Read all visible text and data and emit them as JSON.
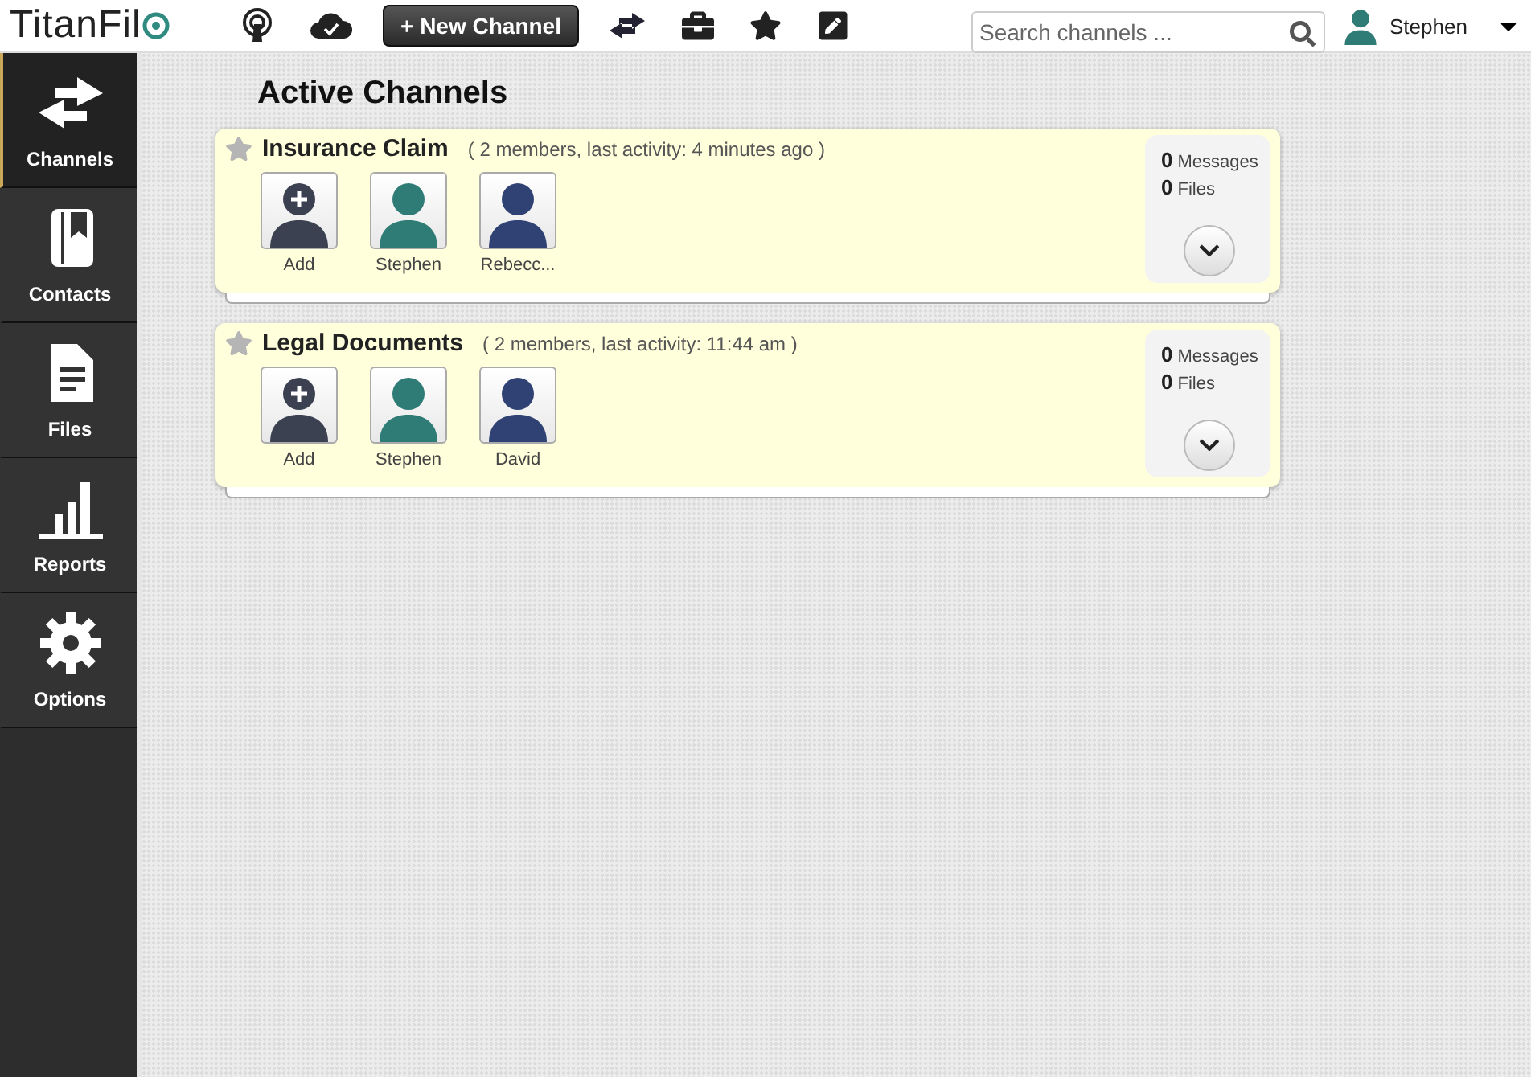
{
  "header": {
    "logo": "TitanFil",
    "new_channel_button": "+ New Channel",
    "search": {
      "placeholder": "Search channels ..."
    },
    "user": {
      "name": "Stephen"
    }
  },
  "sidebar": {
    "items": [
      {
        "label": "Channels",
        "kind": "channels",
        "selected": true
      },
      {
        "label": "Contacts",
        "kind": "contacts",
        "selected": false
      },
      {
        "label": "Files",
        "kind": "files",
        "selected": false
      },
      {
        "label": "Reports",
        "kind": "reports",
        "selected": false
      },
      {
        "label": "Options",
        "kind": "options",
        "selected": false
      }
    ]
  },
  "page_title": "Active Channels",
  "channels": [
    {
      "name": "Insurance Claim",
      "info": "( 2 members, last activity: 4 minutes ago )",
      "messages": "0",
      "messages_label": "Messages",
      "files": "0",
      "files_label": "Files",
      "members": [
        {
          "kind": "add",
          "label": "Add",
          "color": "#3b4150"
        },
        {
          "kind": "member",
          "label": "Stephen",
          "color": "#2f7b76"
        },
        {
          "kind": "member",
          "label": "Rebecc...",
          "color": "#2f4273"
        }
      ]
    },
    {
      "name": "Legal Documents",
      "info": "( 2 members, last activity: 11:44 am )",
      "messages": "0",
      "messages_label": "Messages",
      "files": "0",
      "files_label": "Files",
      "members": [
        {
          "kind": "add",
          "label": "Add",
          "color": "#3b4150"
        },
        {
          "kind": "member",
          "label": "Stephen",
          "color": "#2f7b76"
        },
        {
          "kind": "member",
          "label": "David",
          "color": "#2f4273"
        }
      ]
    }
  ]
}
